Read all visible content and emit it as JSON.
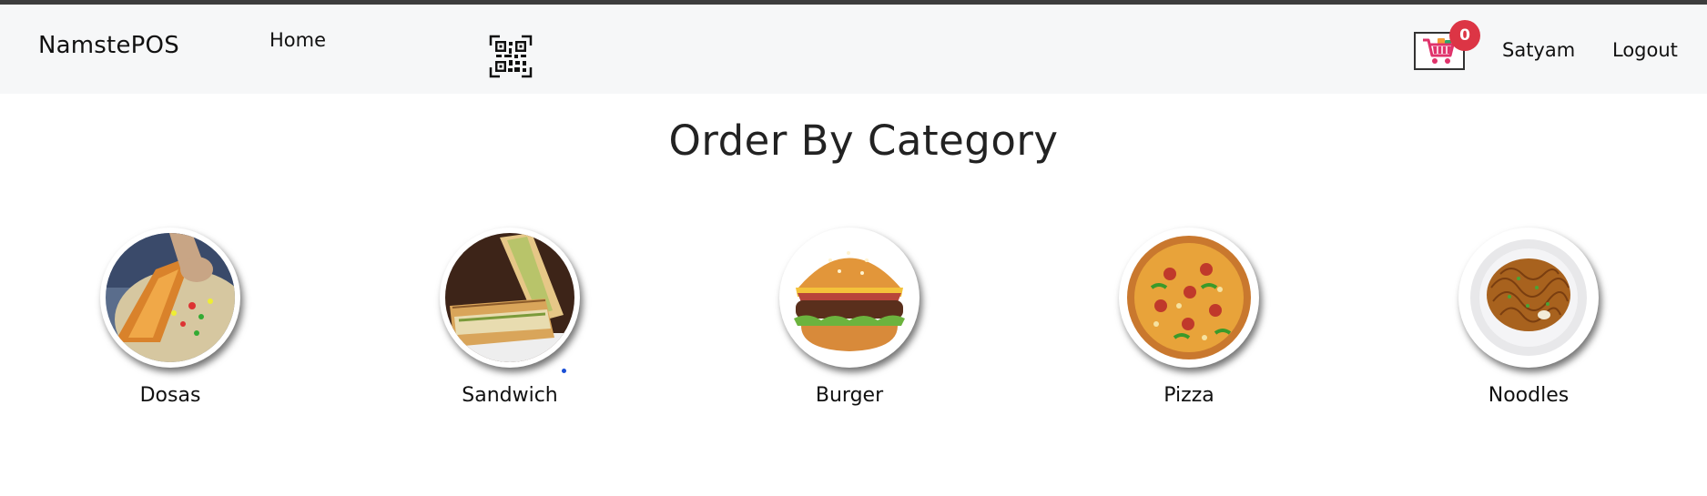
{
  "navbar": {
    "brand": "NamstePOS",
    "home_label": "Home",
    "qr_icon": "qr-code-icon",
    "cart": {
      "icon": "shopping-cart-icon",
      "count": "0"
    },
    "user_name": "Satyam",
    "logout_label": "Logout"
  },
  "main": {
    "heading": "Order By Category",
    "categories": [
      {
        "label": "Dosas",
        "image": "dosa-image"
      },
      {
        "label": "Sandwich",
        "image": "sandwich-image"
      },
      {
        "label": "Burger",
        "image": "burger-image"
      },
      {
        "label": "Pizza",
        "image": "pizza-image"
      },
      {
        "label": "Noodles",
        "image": "noodles-image"
      }
    ]
  },
  "colors": {
    "navbar_bg": "#f6f7f8",
    "badge": "#dc3545",
    "cart_icon": "#e0336b"
  }
}
